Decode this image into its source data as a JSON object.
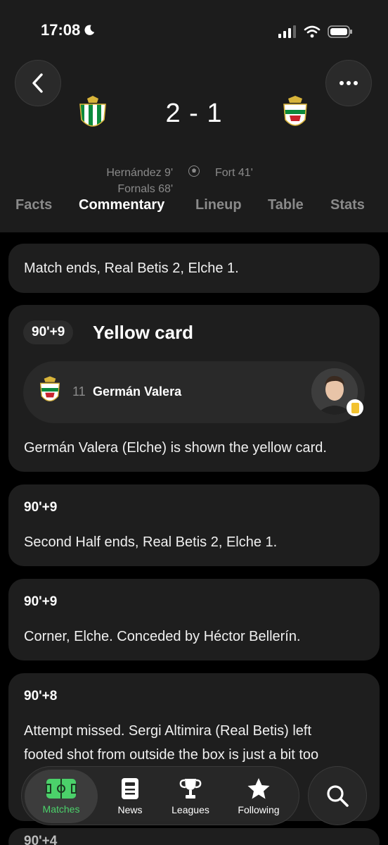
{
  "status_bar": {
    "time": "17:08",
    "icons": [
      "moon-icon",
      "signal-icon",
      "wifi-icon",
      "battery-icon"
    ]
  },
  "match": {
    "home_team": "Real Betis",
    "away_team": "Elche",
    "score": "2 - 1",
    "home_scorers": [
      "Hernández 9'",
      "Fornals 68'"
    ],
    "away_scorers": [
      "Fort 41'"
    ]
  },
  "tabs": [
    {
      "label": "Facts",
      "active": false
    },
    {
      "label": "Commentary",
      "active": true
    },
    {
      "label": "Lineup",
      "active": false
    },
    {
      "label": "Table",
      "active": false
    },
    {
      "label": "Stats",
      "active": false
    }
  ],
  "commentary": {
    "match_end": "Match ends, Real Betis 2, Elche 1.",
    "yellow_card": {
      "minute": "90'+9",
      "title": "Yellow card",
      "shirt_number": "11",
      "player": "Germán Valera",
      "text": "Germán Valera (Elche) is shown the yellow card."
    },
    "entries": [
      {
        "minute": "90'+9",
        "text": "Second Half ends, Real Betis 2, Elche 1."
      },
      {
        "minute": "90'+9",
        "text": "Corner, Elche. Conceded by Héctor Bellerín."
      },
      {
        "minute": "90'+8",
        "text_lines": [
          "Attempt missed. Sergi Altimira (Real Betis) left",
          "footed shot from outside the box is just a bit too"
        ]
      },
      {
        "minute": "90'+4"
      }
    ]
  },
  "bottom_nav": [
    {
      "label": "Matches",
      "icon": "pitch-icon",
      "active": true
    },
    {
      "label": "News",
      "icon": "news-icon",
      "active": false
    },
    {
      "label": "Leagues",
      "icon": "trophy-icon",
      "active": false
    },
    {
      "label": "Following",
      "icon": "star-icon",
      "active": false
    }
  ],
  "colors": {
    "accent": "#4bd16a",
    "background": "#000000",
    "card": "#1e1e1e",
    "header": "#1c1c1c",
    "yellow_card": "#f2c230"
  }
}
